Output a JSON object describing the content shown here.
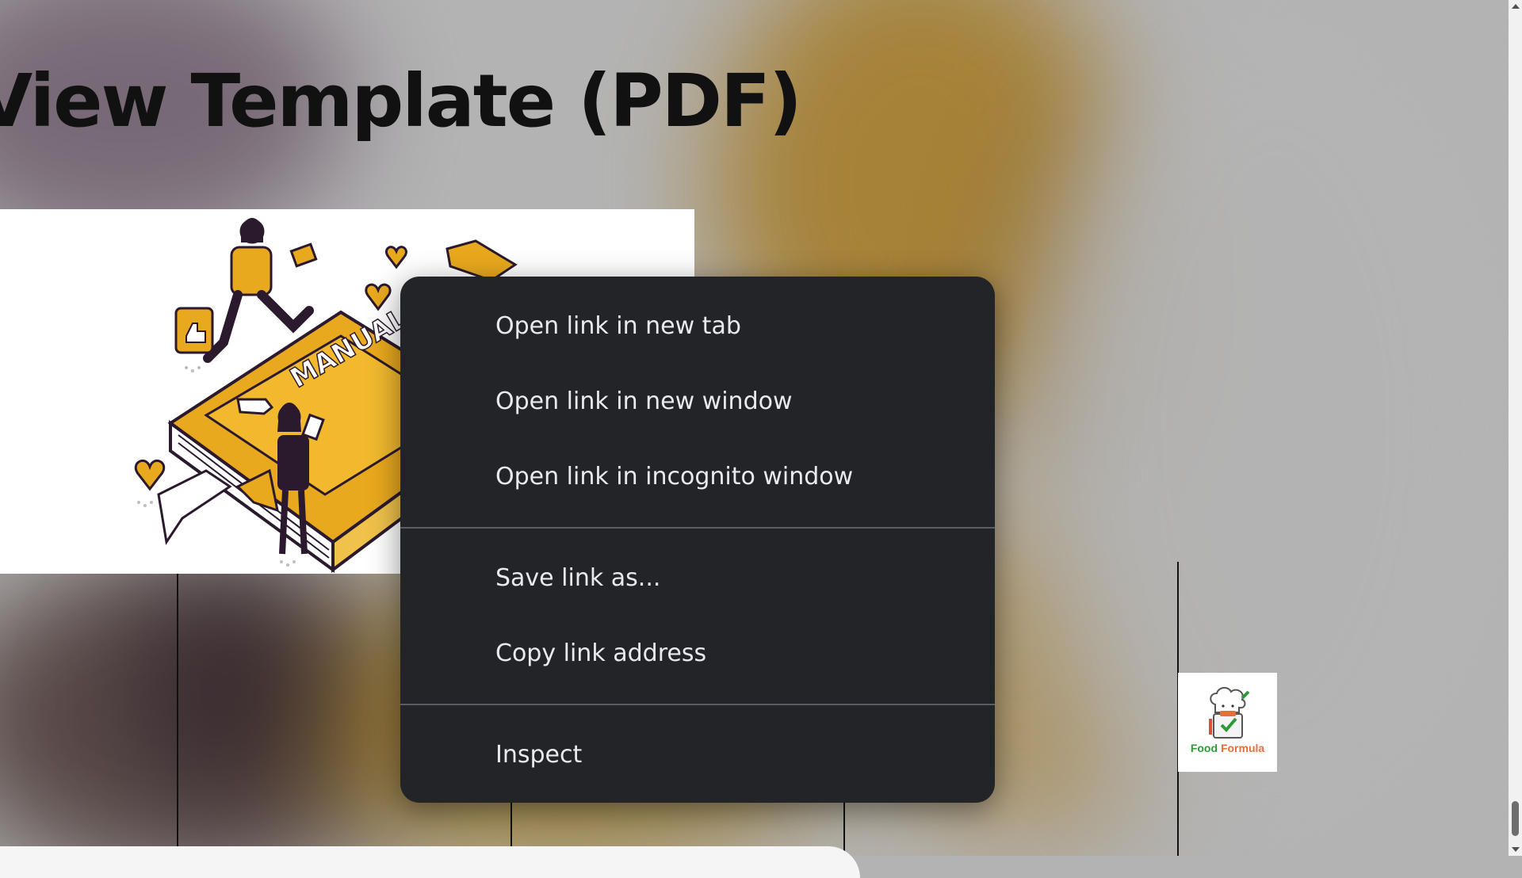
{
  "page": {
    "title": "View Template (PDF)"
  },
  "hero_image": {
    "book_label": "MANUAL"
  },
  "logo": {
    "word1": "Food",
    "word2": "Formula"
  },
  "context_menu": {
    "groups": [
      [
        "Open link in new tab",
        "Open link in new window",
        "Open link in incognito window"
      ],
      [
        "Save link as...",
        "Copy link address"
      ],
      [
        "Inspect"
      ]
    ]
  },
  "colors": {
    "menu_bg": "#232428",
    "menu_text": "#e8eaed",
    "accent_yellow": "#e8a91e",
    "dark_ink": "#2b1a2e",
    "logo_green": "#2e9a36",
    "logo_orange": "#e2703a"
  }
}
